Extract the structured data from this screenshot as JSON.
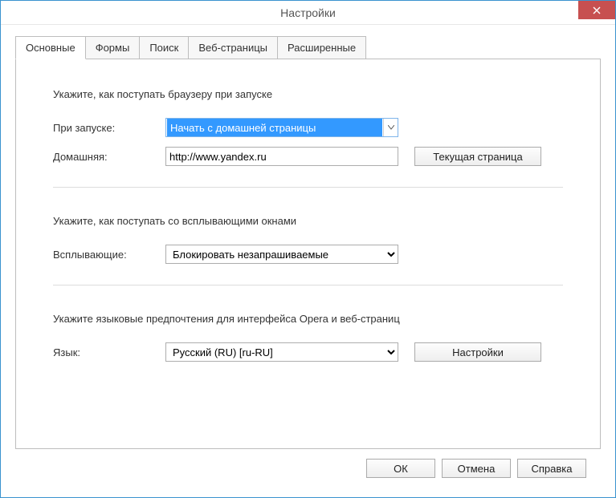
{
  "window": {
    "title": "Настройки"
  },
  "tabs": {
    "main": "Основные",
    "forms": "Формы",
    "search": "Поиск",
    "webpages": "Веб-страницы",
    "advanced": "Расширенные"
  },
  "section_startup": {
    "heading": "Укажите, как поступать браузеру при запуске",
    "label_on_start": "При запуске:",
    "value_on_start": "Начать с домашней страницы",
    "label_home": "Домашняя:",
    "value_home": "http://www.yandex.ru",
    "button_current": "Текущая страница"
  },
  "section_popups": {
    "heading": "Укажите, как поступать со всплывающими окнами",
    "label_popups": "Всплывающие:",
    "value_popups": "Блокировать незапрашиваемые"
  },
  "section_language": {
    "heading": "Укажите языковые предпочтения для интерфейса Opera и веб-страниц",
    "label_lang": "Язык:",
    "value_lang": "Русский (RU) [ru-RU]",
    "button_settings": "Настройки"
  },
  "footer": {
    "ok": "ОК",
    "cancel": "Отмена",
    "help": "Справка"
  }
}
